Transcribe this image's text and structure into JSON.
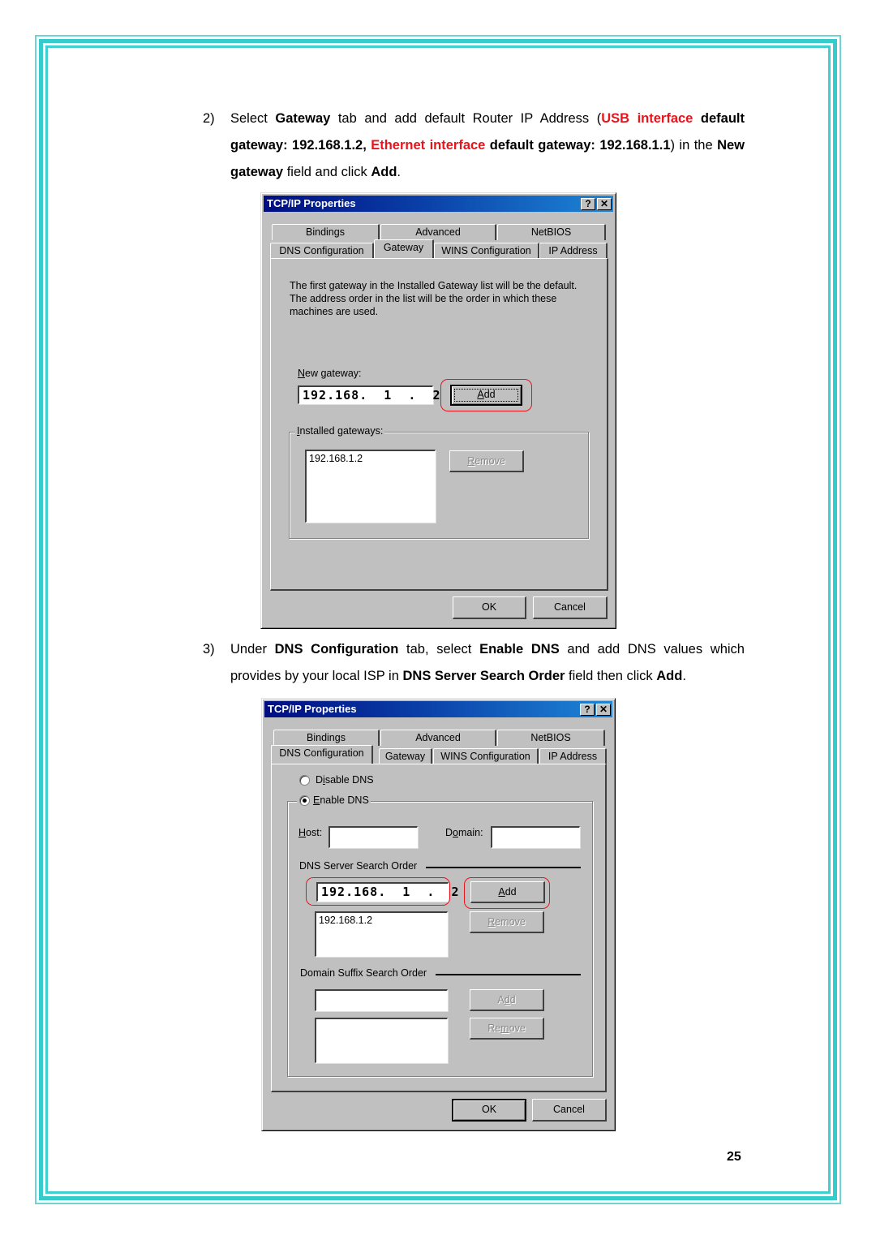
{
  "page_number": "25",
  "step2": {
    "number": "2)",
    "runs": [
      {
        "t": "Select ",
        "s": "n"
      },
      {
        "t": "Gateway",
        "s": "b"
      },
      {
        "t": " tab and add default Router IP Address (",
        "s": "n"
      },
      {
        "t": "USB interface",
        "s": "r"
      },
      {
        "t": " default gateway: 192.168.1.2, ",
        "s": "b"
      },
      {
        "t": "Ethernet interface",
        "s": "r"
      },
      {
        "t": " default gateway: 192.168.1.1",
        "s": "b"
      },
      {
        "t": ") in the ",
        "s": "n"
      },
      {
        "t": "New gateway",
        "s": "b"
      },
      {
        "t": " field and click ",
        "s": "n"
      },
      {
        "t": "Add",
        "s": "b"
      },
      {
        "t": ".",
        "s": "n"
      }
    ]
  },
  "step3": {
    "number": "3)",
    "runs": [
      {
        "t": "Under ",
        "s": "n"
      },
      {
        "t": "DNS Configuration",
        "s": "b"
      },
      {
        "t": " tab, select ",
        "s": "n"
      },
      {
        "t": "Enable DNS",
        "s": "b"
      },
      {
        "t": " and add DNS values which provides by your local ISP in ",
        "s": "n"
      },
      {
        "t": "DNS Server Search Order",
        "s": "b"
      },
      {
        "t": " field then click ",
        "s": "n"
      },
      {
        "t": "Add",
        "s": "b"
      },
      {
        "t": ".",
        "s": "n"
      }
    ]
  },
  "dialog1": {
    "title": "TCP/IP Properties",
    "help_glyph": "?",
    "close_glyph": "✕",
    "tabs_row1": [
      "Bindings",
      "Advanced",
      "NetBIOS"
    ],
    "tabs_row2": [
      "DNS Configuration",
      "Gateway",
      "WINS Configuration",
      "IP Address"
    ],
    "active_tab": "Gateway",
    "description": [
      "The first gateway in the Installed Gateway list will be the default.",
      "The address order in the list will be the order in which these",
      "machines are used."
    ],
    "new_gateway_label": "New gateway:",
    "new_gateway_value": "192.168.  1  .  2",
    "add_label": "Add",
    "installed_label": "Installed gateways:",
    "installed_items": [
      "192.168.1.2"
    ],
    "remove_label": "Remove",
    "ok_label": "OK",
    "cancel_label": "Cancel"
  },
  "dialog2": {
    "title": "TCP/IP Properties",
    "help_glyph": "?",
    "close_glyph": "✕",
    "tabs_row1": [
      "Bindings",
      "Advanced",
      "NetBIOS"
    ],
    "tabs_row2": [
      "DNS Configuration",
      "Gateway",
      "WINS Configuration",
      "IP Address"
    ],
    "active_tab": "DNS Configuration",
    "disable_dns_label": "Disable DNS",
    "enable_dns_label": "Enable DNS",
    "dns_enabled": true,
    "host_label": "Host:",
    "host_value": "",
    "domain_label": "Domain:",
    "domain_value": "",
    "dns_server_order_label": "DNS Server Search Order",
    "dns_server_value": "192.168.  1  .  2",
    "add_label": "Add",
    "dns_items": [
      "192.168.1.2"
    ],
    "remove_label": "Remove",
    "suffix_order_label": "Domain Suffix Search Order",
    "suffix_value": "",
    "suffix_add_label": "Add",
    "suffix_remove_label": "Remove",
    "ok_label": "OK",
    "cancel_label": "Cancel"
  },
  "colors": {
    "border": "#36cccc",
    "highlight": "#e8141b",
    "titlebar_start": "#000d80",
    "titlebar_end": "#1d86d6",
    "dialog_face": "#c0c0c0"
  }
}
